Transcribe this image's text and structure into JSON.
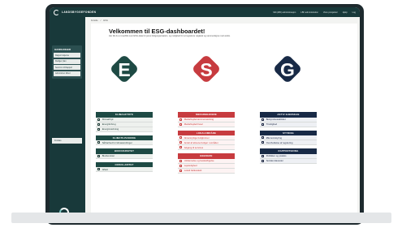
{
  "header": {
    "logo_text": "LANDSBYGGEFONDEN",
    "nav": [
      "Mitt (ØR) administrasjon",
      "LBF administration",
      "Vis/e prosjekter",
      "Hjelp",
      "Log"
    ]
  },
  "sidebar": {
    "menu_title": "HANDLINGER",
    "items": [
      "Rapport skjema",
      "Rediger plan",
      "Send inn til Rapport",
      "Administrer tilbud"
    ],
    "bottom_item": "Frelsas"
  },
  "breadcrumb": [
    "Forside",
    "/",
    "ESG"
  ],
  "page": {
    "title": "Velkommen til ESG-dashboardet!",
    "intro": "Her får du et overblik over ESG-data for jeres boligorganisation, og mulighed for at registrere nøgletal og sammenligne med andre."
  },
  "pillars": [
    {
      "letter": "E",
      "color": "#1e4a44"
    },
    {
      "letter": "S",
      "color": "#c73b3f"
    },
    {
      "letter": "G",
      "color": "#182a46"
    }
  ],
  "columns": {
    "e": [
      {
        "title": "KLIMAAFTRYK",
        "items": [
          "Klimaaftryk",
          "Energiforbrug",
          "Energimærkning"
        ]
      },
      {
        "title": "KLIMATILPASNING",
        "items": [
          "Sårbarhed for klimaændringer"
        ]
      },
      {
        "title": "BIODIVERSITET",
        "items": [
          "Biodiversitet"
        ]
      },
      {
        "title": "CIRKULARITET",
        "items": [
          "Affald"
        ]
      }
    ],
    "s": [
      {
        "title": "MEDARBEJDERE",
        "items": [
          "Medarbejdersammensætning",
          "Medarbejdertrivsel"
        ]
      },
      {
        "title": "LOKALOMRÅDE",
        "items": [
          "Almennyttige boligformer",
          "Andel af almene boliger i området",
          "Adgang til services"
        ]
      },
      {
        "title": "BEBOERE",
        "items": [
          "Uddannelse og beskæftigelse",
          "Lejeledighed",
          "Lokalt fællesskab"
        ]
      }
    ],
    "g": [
      {
        "title": "AKTIV EJERSKAB",
        "items": [
          "Bestyrelsesaktivitet",
          "Trivslighed"
        ]
      },
      {
        "title": "STYRING",
        "items": [
          "Økonomistyring",
          "Overholdelse af regulering"
        ]
      },
      {
        "title": "RAPPORTERING",
        "items": [
          "Politikker og praksis",
          "Sociale klausuler"
        ]
      }
    ]
  }
}
